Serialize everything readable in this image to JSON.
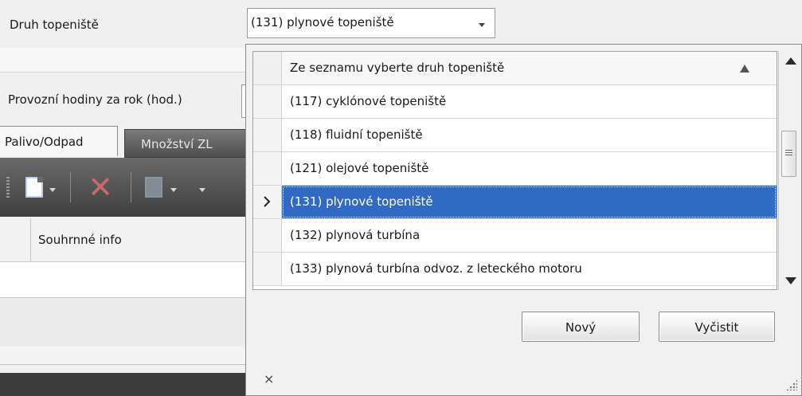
{
  "form": {
    "druh_label": "Druh topeniště",
    "provozni_label": "Provozní hodiny za rok (hod.)",
    "tabs": [
      {
        "label": "Palivo/Odpad",
        "active": true
      },
      {
        "label": "Množství ZL",
        "active": false
      }
    ],
    "grid_column": "Souhrnné info"
  },
  "combo": {
    "value": "(131) plynové topeniště"
  },
  "dropdown": {
    "header": "Ze seznamu vyberte druh topeniště",
    "items": [
      {
        "label": "(117) cyklónové topeniště",
        "selected": false
      },
      {
        "label": "(118) fluidní topeniště",
        "selected": false
      },
      {
        "label": "(121) olejové topeniště",
        "selected": false
      },
      {
        "label": "(131) plynové topeniště",
        "selected": true
      },
      {
        "label": "(132) plynová turbína",
        "selected": false
      },
      {
        "label": "(133) plynová turbína odvoz. z leteckého motoru",
        "selected": false
      }
    ],
    "buttons": {
      "new_label": "Nový",
      "clear_label": "Vyčistit"
    },
    "close_glyph": "×"
  },
  "colors": {
    "selection": "#316ac5",
    "toolbar": "#4e4e4e"
  }
}
